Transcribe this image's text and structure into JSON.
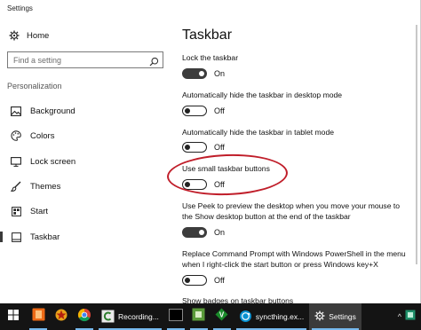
{
  "window": {
    "title": "Settings"
  },
  "sidebar": {
    "home_label": "Home",
    "search_placeholder": "Find a setting",
    "section_label": "Personalization",
    "items": [
      {
        "label": "Background",
        "icon": "picture-icon"
      },
      {
        "label": "Colors",
        "icon": "palette-icon"
      },
      {
        "label": "Lock screen",
        "icon": "monitor-icon"
      },
      {
        "label": "Themes",
        "icon": "brush-icon"
      },
      {
        "label": "Start",
        "icon": "start-tiles-icon"
      },
      {
        "label": "Taskbar",
        "icon": "taskbar-icon",
        "selected": true
      }
    ]
  },
  "main": {
    "title": "Taskbar",
    "settings": [
      {
        "label": "Lock the taskbar",
        "state": "On"
      },
      {
        "label": "Automatically hide the taskbar in desktop mode",
        "state": "Off"
      },
      {
        "label": "Automatically hide the taskbar in tablet mode",
        "state": "Off"
      },
      {
        "label": "Use small taskbar buttons",
        "state": "Off"
      },
      {
        "label_lines": [
          "Use Peek to preview the desktop when you move your mouse to",
          "the Show desktop button at the end of the taskbar"
        ],
        "state": "On"
      },
      {
        "label_lines": [
          "Replace Command Prompt with Windows PowerShell in the menu",
          "when I right-click the start button or press Windows key+X"
        ],
        "state": "Off"
      },
      {
        "label": "Show badges on taskbar buttons"
      }
    ]
  },
  "taskbar": {
    "apps": [
      {
        "label": "Recording...",
        "icon": "camtasia-icon"
      },
      {
        "label": "syncthing.ex...",
        "icon": "syncthing-icon"
      },
      {
        "label": "Settings",
        "icon": "gear-icon",
        "active": true
      }
    ]
  },
  "colors": {
    "highlight": "#c01e2a",
    "taskbar": "#141414",
    "toggle_on": "#3c3c3c"
  }
}
